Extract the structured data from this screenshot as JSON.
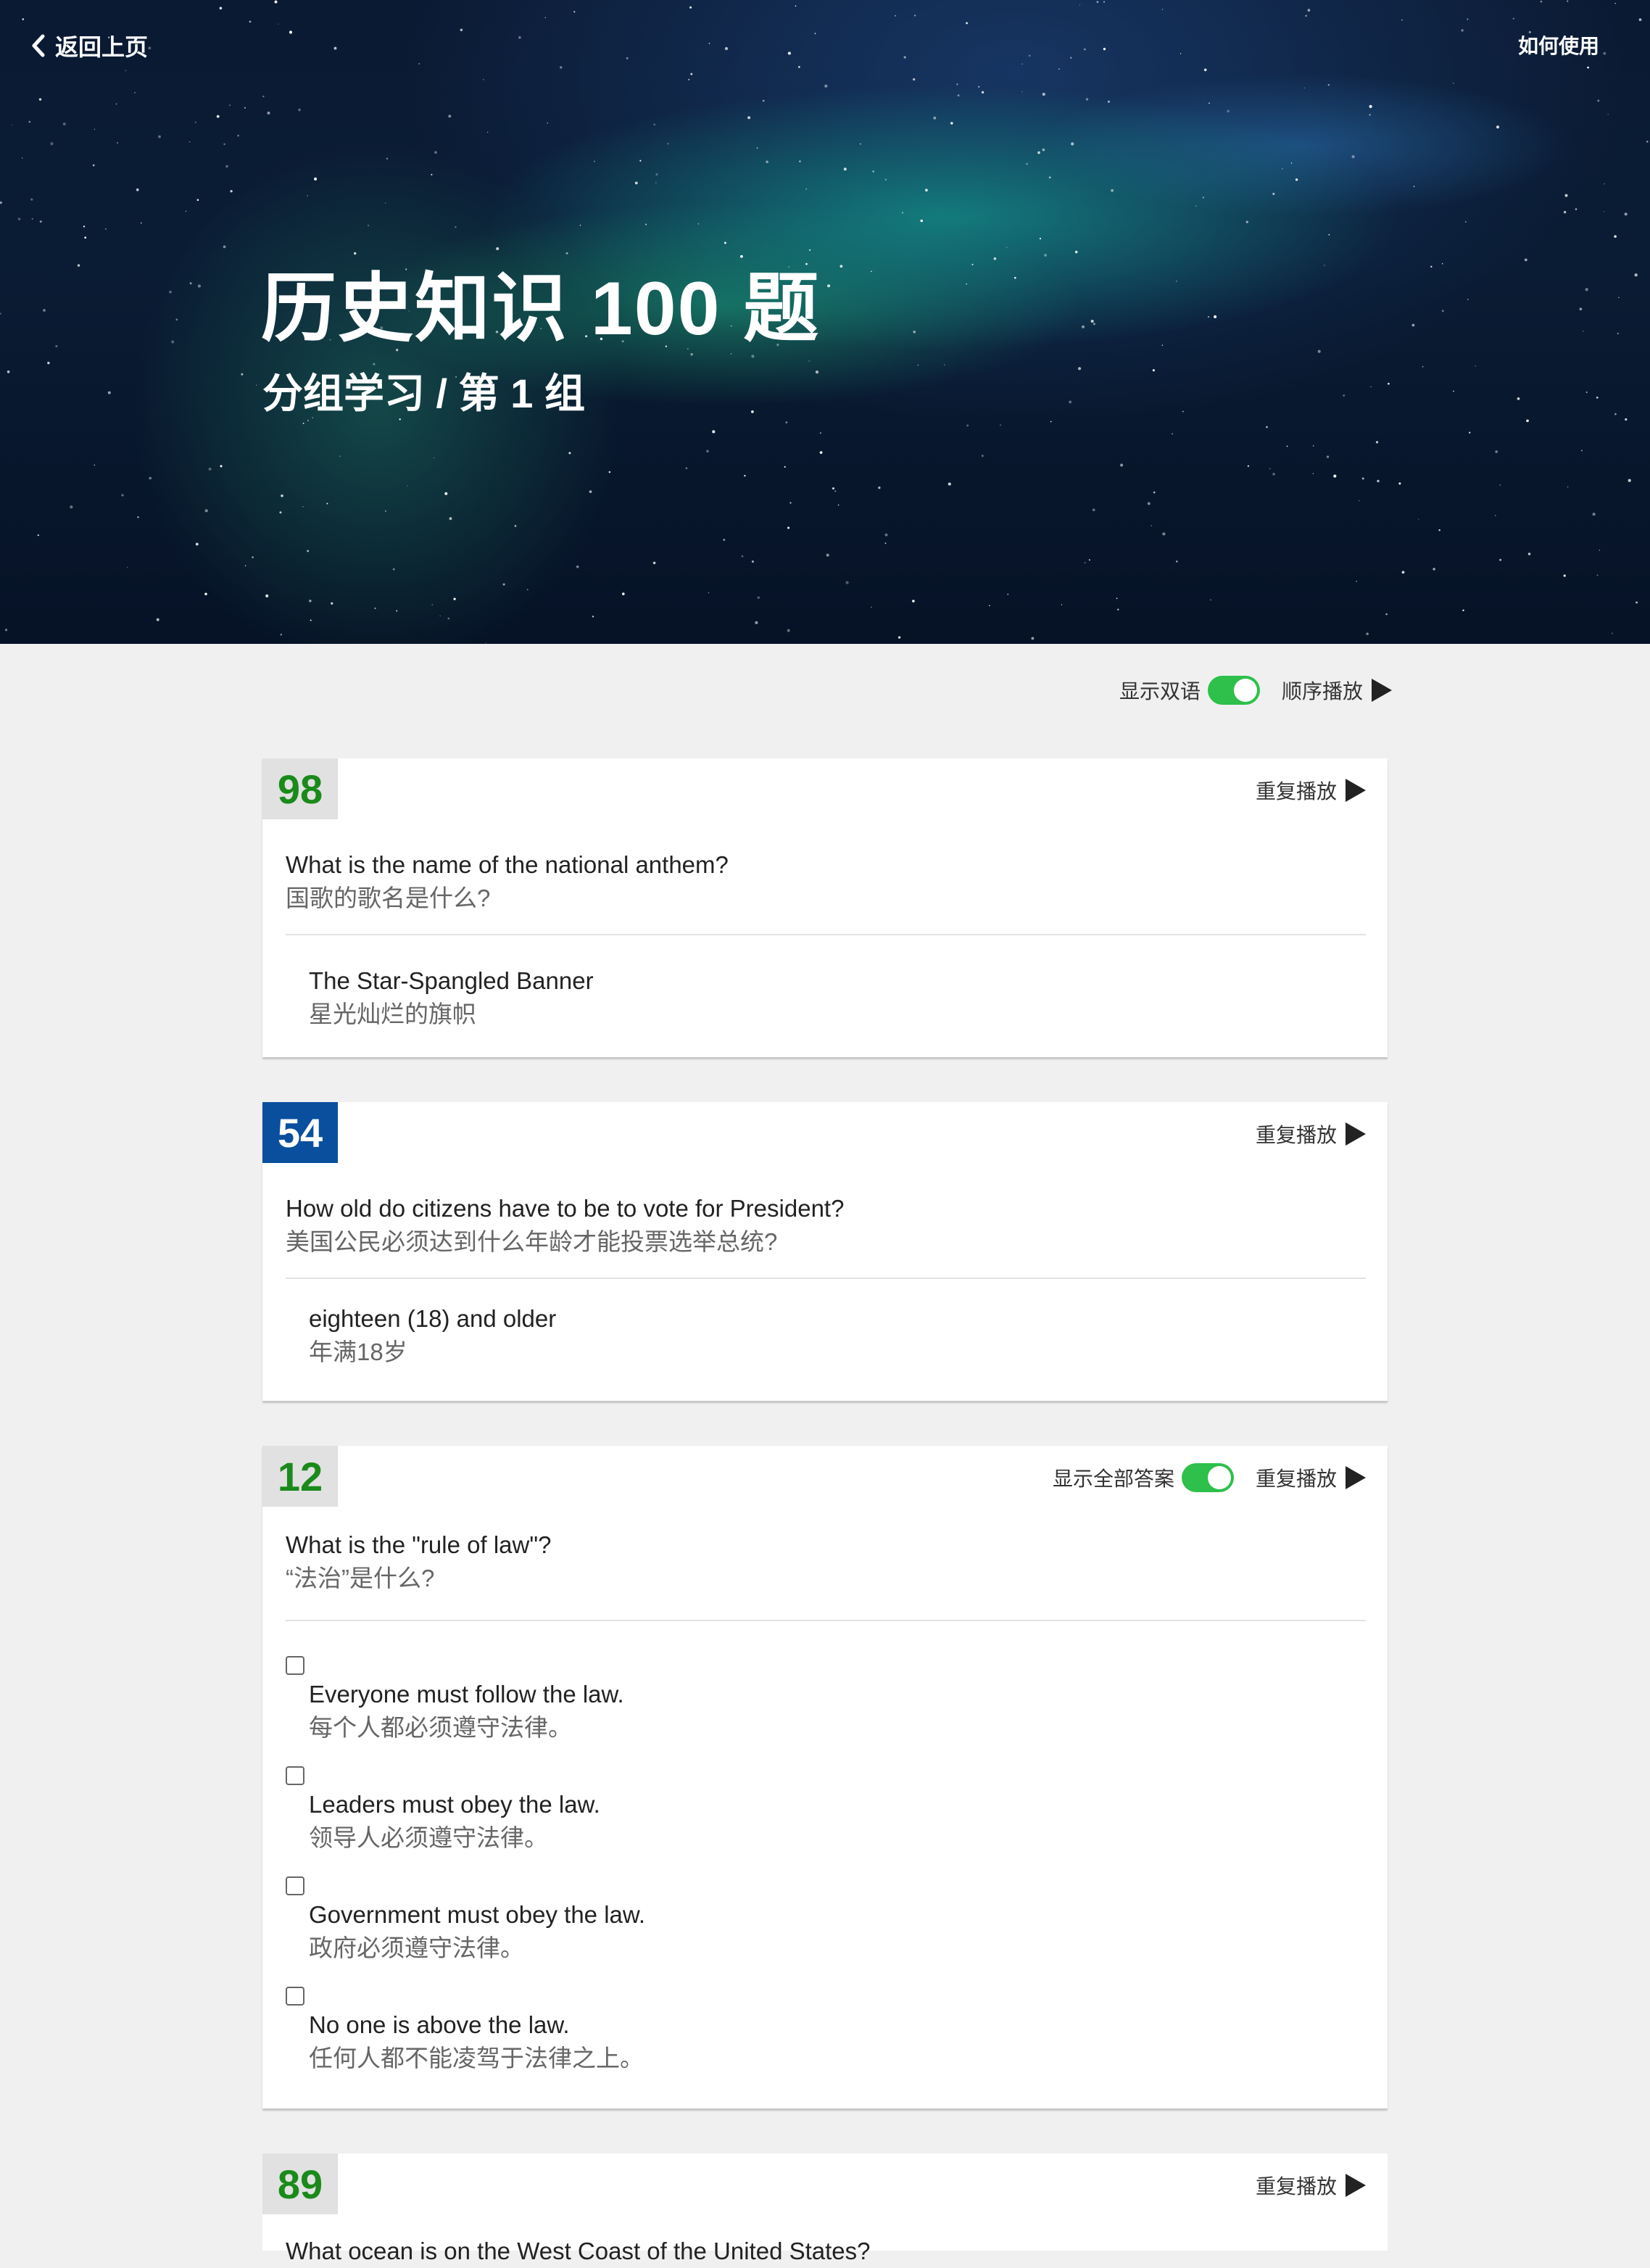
{
  "nav": {
    "back_label": "返回上页",
    "how_to_label": "如何使用"
  },
  "hero": {
    "title": "历史知识 100 题",
    "subtitle": "分组学习 / 第 1 组"
  },
  "controls": {
    "bilingual_label": "显示双语",
    "bilingual_on": true,
    "sequential_play_label": "顺序播放"
  },
  "colors": {
    "toggle_on": "#2ec04b",
    "number_green": "#1a8a1a",
    "number_blue_bg": "#0a4f9e"
  },
  "cards": [
    {
      "number": "98",
      "badge_style": "green",
      "replay_label": "重复播放",
      "question_en": "What is the name of the national anthem?",
      "question_zh": "国歌的歌名是什么?",
      "answers": [
        {
          "en": "The Star-Spangled Banner",
          "zh": "星光灿烂的旗帜"
        }
      ]
    },
    {
      "number": "54",
      "badge_style": "blue",
      "replay_label": "重复播放",
      "question_en": "How old do citizens have to be to vote for President?",
      "question_zh": "美国公民必须达到什么年龄才能投票选举总统?",
      "answers": [
        {
          "en": "eighteen (18) and older",
          "zh": "年满18岁"
        }
      ]
    },
    {
      "number": "12",
      "badge_style": "green",
      "show_all_label": "显示全部答案",
      "show_all_on": true,
      "replay_label": "重复播放",
      "question_en": "What is the \"rule of law\"?",
      "question_zh": "“法治”是什么?",
      "options": [
        {
          "en": "Everyone must follow the law.",
          "zh": "每个人都必须遵守法律。",
          "checked": false
        },
        {
          "en": "Leaders must obey the law.",
          "zh": "领导人必须遵守法律。",
          "checked": false
        },
        {
          "en": "Government must obey the law.",
          "zh": "政府必须遵守法律。",
          "checked": false
        },
        {
          "en": "No one is above the law.",
          "zh": "任何人都不能凌驾于法律之上。",
          "checked": false
        }
      ]
    },
    {
      "number": "89",
      "badge_style": "green",
      "replay_label": "重复播放",
      "question_en": "What ocean is on the West Coast of the United States?"
    }
  ]
}
